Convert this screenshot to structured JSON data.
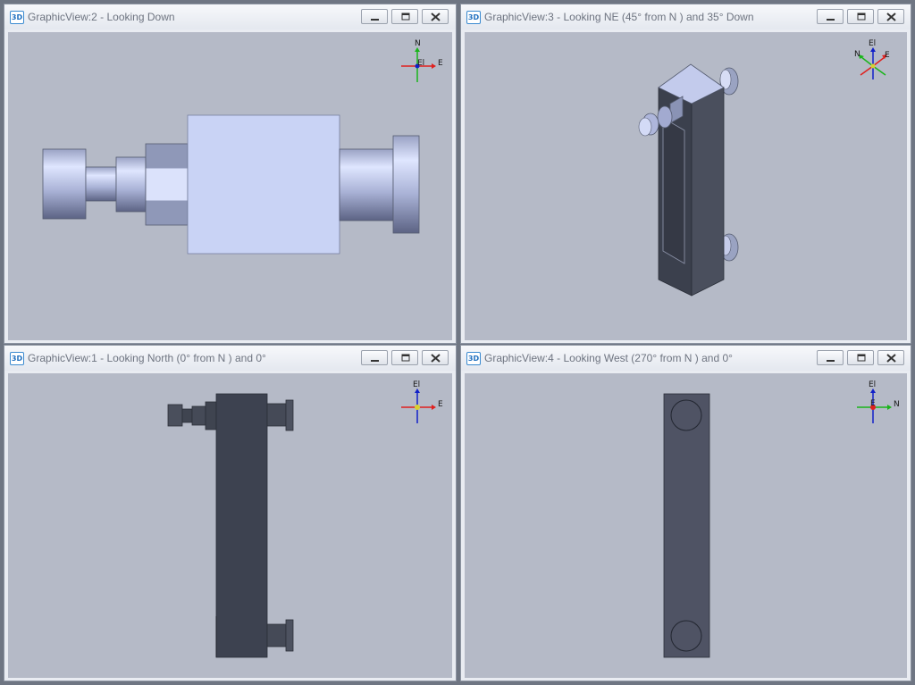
{
  "colors": {
    "viewport_bg": "#b5bac7",
    "body_dark": "#3d4250",
    "part_light": "#c9d3f5",
    "axis_north": "#19b51a",
    "axis_east": "#e0201e",
    "axis_up": "#1020c8"
  },
  "panes": [
    {
      "icon": "3D",
      "title": "GraphicView:2 - Looking Down",
      "triad": {
        "top": "N",
        "right": "E",
        "center": "El"
      }
    },
    {
      "icon": "3D",
      "title": "GraphicView:3 - Looking NE (45° from N ) and 35° Down",
      "triad": {
        "top": "El",
        "left": "N",
        "right": "E"
      }
    },
    {
      "icon": "3D",
      "title": "GraphicView:1 - Looking North (0° from N ) and 0°",
      "triad": {
        "top": "El",
        "right": "E"
      }
    },
    {
      "icon": "3D",
      "title": "GraphicView:4 - Looking West (270° from N ) and 0°",
      "triad": {
        "top": "El",
        "right": "N",
        "center": "E"
      }
    }
  ]
}
